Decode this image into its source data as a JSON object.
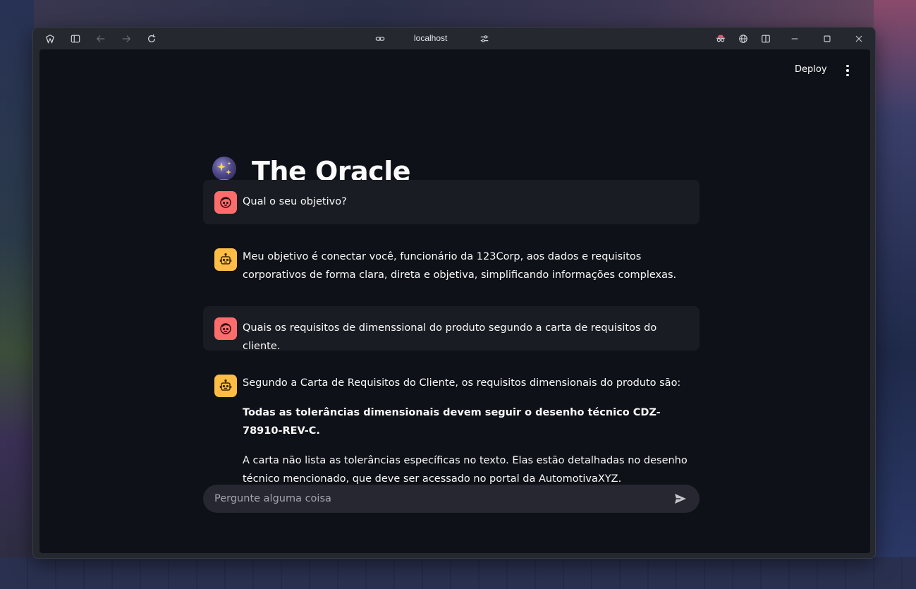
{
  "browser": {
    "url": "localhost",
    "icons": [
      "app-logo-icon",
      "sidebar-toggle-icon",
      "back-icon",
      "forward-icon",
      "reload-icon",
      "link-icon",
      "site-settings-icon",
      "incognito-icon",
      "globe-icon",
      "split-view-icon",
      "minimize-icon",
      "maximize-icon",
      "close-icon"
    ]
  },
  "toolbar": {
    "deploy_label": "Deploy"
  },
  "app": {
    "title": "The Oracle",
    "title_icon": "crystal-ball-icon"
  },
  "messages": [
    {
      "role": "user",
      "text": "Qual o seu objetivo?"
    },
    {
      "role": "assistant",
      "text": "Meu objetivo é conectar você, funcionário da 123Corp, aos dados e requisitos corporativos de forma clara, direta e objetiva, simplificando informações complexas."
    },
    {
      "role": "user",
      "text": "Quais os requisitos de dimenssional do produto segundo a carta de requisitos do cliente."
    },
    {
      "role": "assistant",
      "intro": "Segundo a Carta de Requisitos do Cliente, os requisitos dimensionais do produto são:",
      "bold": "Todas as tolerâncias dimensionais devem seguir o desenho técnico CDZ-78910-REV-C.",
      "detail": "A carta não lista as tolerâncias específicas no texto. Elas estão detalhadas no desenho técnico mencionado, que deve ser acessado no portal da AutomotivaXYZ."
    }
  ],
  "chat_input": {
    "placeholder": "Pergunte alguma coisa",
    "value": ""
  },
  "colors": {
    "page_bg": "#0e1117",
    "user_bubble": "#1a1c24",
    "user_avatar": "#ff6c6c",
    "bot_avatar": "#ffbd45",
    "input_bg": "#262730"
  }
}
